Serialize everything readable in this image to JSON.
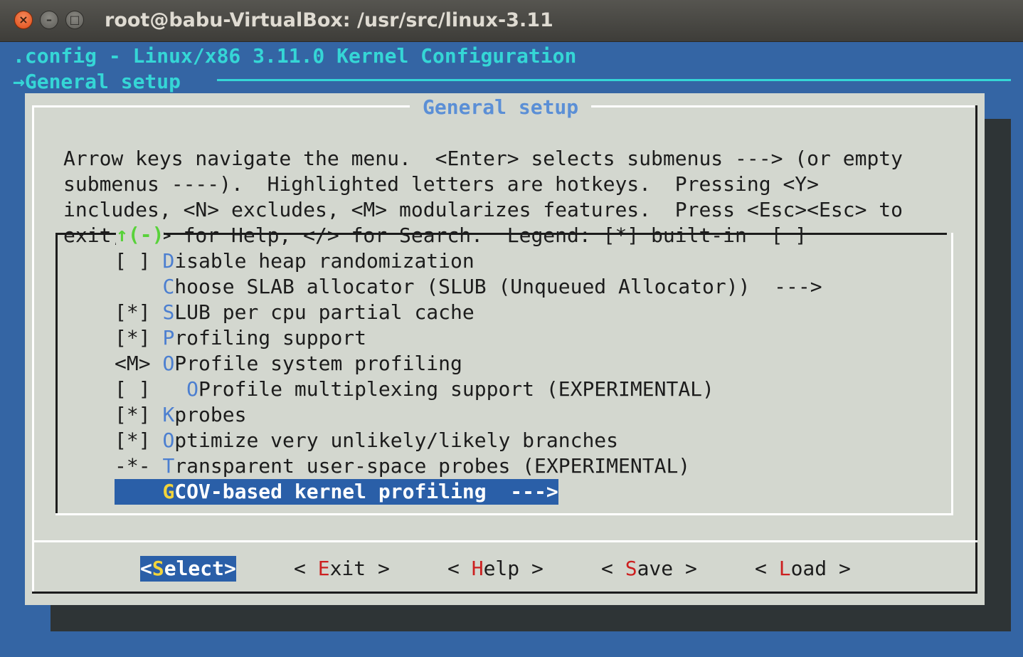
{
  "window": {
    "title": "root@babu-VirtualBox: /usr/src/linux-3.11",
    "close_glyph": "×",
    "minimize_glyph": "–",
    "maximize_glyph": "□"
  },
  "header": {
    "config_title": ".config - Linux/x86 3.11.0 Kernel Configuration",
    "breadcrumb": "→General setup"
  },
  "dialog": {
    "title": "General setup",
    "help_lines": [
      "Arrow keys navigate the menu.  <Enter> selects submenus ---> (or empty",
      "submenus ----).  Highlighted letters are hotkeys.  Pressing <Y>",
      "includes, <N> excludes, <M> modularizes features.  Press <Esc><Esc> to",
      "exit, <?> for Help, </> for Search.  Legend: [*] built-in  [ ]"
    ],
    "scroll_indicator": "↑(-)"
  },
  "menu": {
    "items": [
      {
        "prefix": "[ ] ",
        "hotkey": "D",
        "rest": "isable heap randomization"
      },
      {
        "prefix": "    ",
        "hotkey": "C",
        "rest": "hoose SLAB allocator (SLUB (Unqueued Allocator))  --->"
      },
      {
        "prefix": "[*] ",
        "hotkey": "S",
        "rest": "LUB per cpu partial cache"
      },
      {
        "prefix": "[*] ",
        "hotkey": "P",
        "rest": "rofiling support"
      },
      {
        "prefix": "<M> ",
        "hotkey": "O",
        "rest": "Profile system profiling"
      },
      {
        "prefix": "[ ]   ",
        "hotkey": "O",
        "rest": "Profile multiplexing support (EXPERIMENTAL)"
      },
      {
        "prefix": "[*] ",
        "hotkey": "K",
        "rest": "probes"
      },
      {
        "prefix": "[*] ",
        "hotkey": "O",
        "rest": "ptimize very unlikely/likely branches"
      },
      {
        "prefix": "-*- ",
        "hotkey": "T",
        "rest": "ransparent user-space probes (EXPERIMENTAL)"
      },
      {
        "prefix": "    ",
        "hotkey": "G",
        "rest": "COV-based kernel profiling  --->",
        "selected": true
      }
    ]
  },
  "buttons": [
    {
      "left": "<",
      "hotkey": "S",
      "rest": "elect",
      "right": ">",
      "selected": true
    },
    {
      "left": "< ",
      "hotkey": "E",
      "rest": "xit",
      "right": " >"
    },
    {
      "left": "< ",
      "hotkey": "H",
      "rest": "elp",
      "right": " >"
    },
    {
      "left": "< ",
      "hotkey": "S",
      "rest": "ave",
      "right": " >"
    },
    {
      "left": "< ",
      "hotkey": "L",
      "rest": "oad",
      "right": " >"
    }
  ],
  "colors": {
    "terminal_bg": "#3465a4",
    "dialog_bg": "#d3d7cf",
    "header_text": "#35d6d6",
    "hotkey_blue": "#4c7fd0",
    "selection_bg": "#2a5fa8",
    "selection_hotkey": "#f2d43b",
    "button_hotkey": "#cc1f1f",
    "scroll_indicator": "#58d23a"
  }
}
